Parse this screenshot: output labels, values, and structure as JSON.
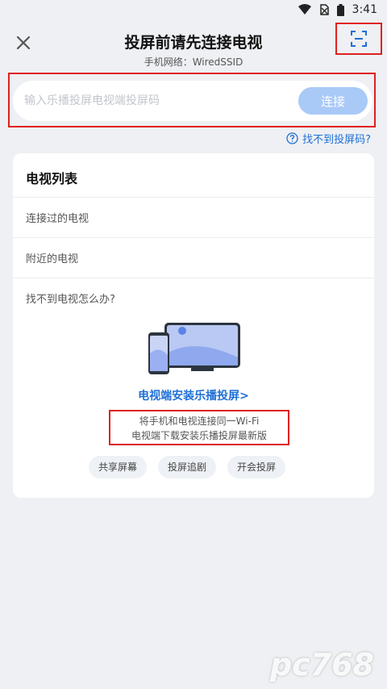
{
  "status_bar": {
    "time": "3:41"
  },
  "header": {
    "title": "投屏前请先连接电视",
    "subtitle": "手机网络：WiredSSID"
  },
  "code_entry": {
    "placeholder": "输入乐播投屏电视端投屏码",
    "connect_label": "连接",
    "help_link": "找不到投屏码?"
  },
  "tv_list": {
    "title": "电视列表",
    "rows": [
      "连接过的电视",
      "附近的电视"
    ],
    "help_question": "找不到电视怎么办?",
    "install_link": "电视端安装乐播投屏>",
    "tips": [
      "将手机和电视连接同一Wi-Fi",
      "电视端下载安装乐播投屏最新版"
    ],
    "chips": [
      "共享屏幕",
      "投屏追剧",
      "开会投屏"
    ]
  },
  "watermark": "pc768",
  "colors": {
    "accent": "#1f6fd6",
    "connect_button": "#a9c9f7",
    "highlight": "#e02020"
  }
}
